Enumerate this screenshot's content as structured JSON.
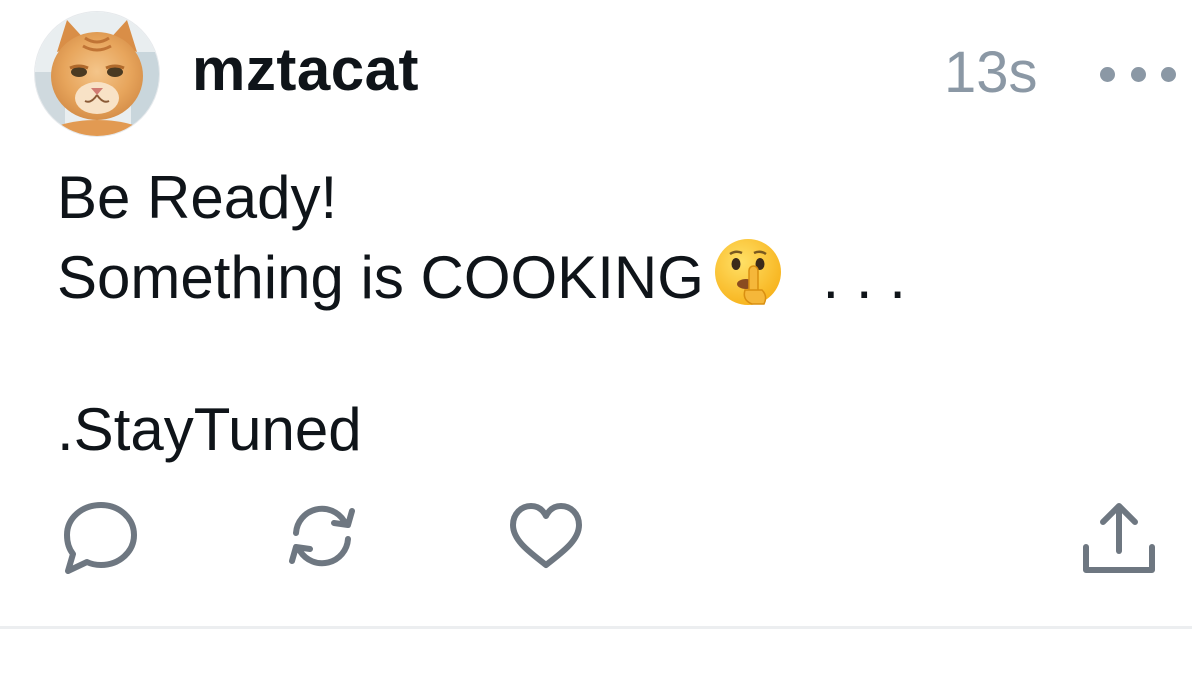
{
  "post": {
    "username": "mztacat",
    "timestamp": "13s",
    "lines": [
      "Be Ready!",
      "Something is COOKING",
      " . . .",
      "",
      ".StayTuned"
    ],
    "emoji_name": "shushing-face"
  },
  "actions": {
    "reply_icon": "reply-icon",
    "repost_icon": "repost-icon",
    "like_icon": "heart-icon",
    "share_icon": "share-icon"
  },
  "colors": {
    "text": "#0f1419",
    "muted": "#8b98a5",
    "icon": "#6e7781",
    "divider": "#eceef0"
  }
}
